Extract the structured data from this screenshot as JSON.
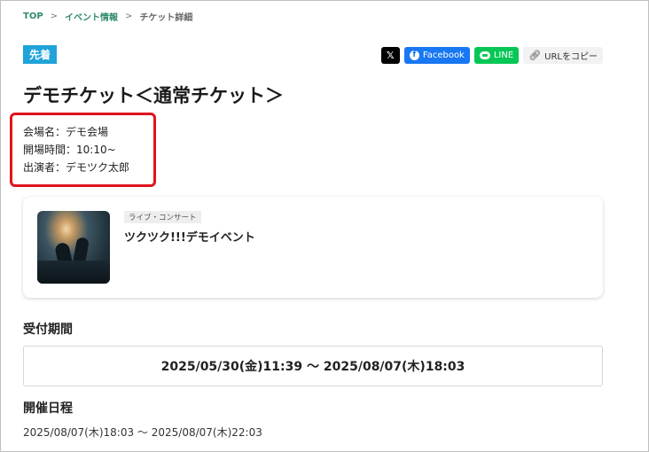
{
  "breadcrumb": {
    "items": [
      {
        "label": "TOP"
      },
      {
        "label": "イベント情報"
      },
      {
        "label": "チケット詳細"
      }
    ],
    "separator": ">"
  },
  "badge": {
    "label": "先着"
  },
  "share": {
    "x_label": "𝕏",
    "facebook_label": "Facebook",
    "line_label": "LINE",
    "copy_label": "URLをコピー"
  },
  "title": "デモチケット＜通常チケット＞",
  "info": {
    "venue": "会場名：デモ会場",
    "open_time": "開場時間：10:10~",
    "performer": "出演者：デモツク太郎"
  },
  "event_card": {
    "category": "ライブ・コンサート",
    "name": "ツクツク!!!デモイベント"
  },
  "reception": {
    "heading": "受付期間",
    "period": "2025/05/30(金)11:39 ～ 2025/08/07(木)18:03"
  },
  "schedule": {
    "heading": "開催日程",
    "period": "2025/08/07(木)18:03 ～ 2025/08/07(木)22:03"
  },
  "colors": {
    "badge": "#1fa3d9",
    "facebook": "#1877f2",
    "line": "#06c755",
    "highlight": "#e0141e",
    "breadcrumb_link": "#2e8b6a"
  }
}
